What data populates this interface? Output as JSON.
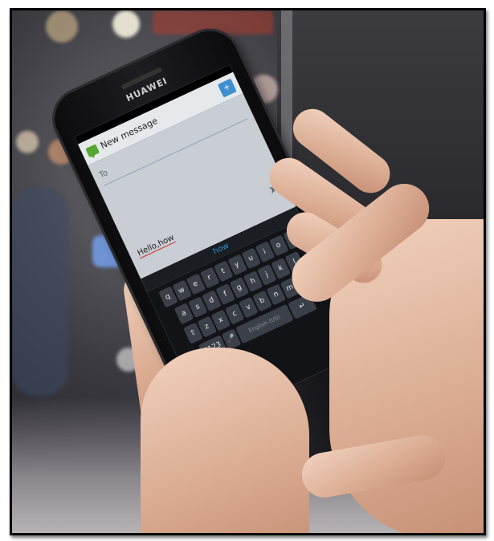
{
  "phone": {
    "brand": "HUAWEI",
    "app_title": "New message",
    "to_label": "To",
    "compose_text": "Hello,how",
    "suggestion": "how",
    "keyboard": {
      "row1": [
        "q",
        "w",
        "e",
        "r",
        "t",
        "y",
        "u",
        "i",
        "o",
        "p"
      ],
      "row2": [
        "a",
        "s",
        "d",
        "f",
        "g",
        "h",
        "j",
        "k",
        "l"
      ],
      "row3": [
        "⇧",
        "z",
        "x",
        "c",
        "v",
        "b",
        "n",
        "m",
        "⌫"
      ],
      "row4_left": "?123",
      "row4_space": "English (US)",
      "row4_right": "↵"
    },
    "nav": {
      "back": "↩",
      "home": "⌂",
      "menu": "≡"
    }
  }
}
